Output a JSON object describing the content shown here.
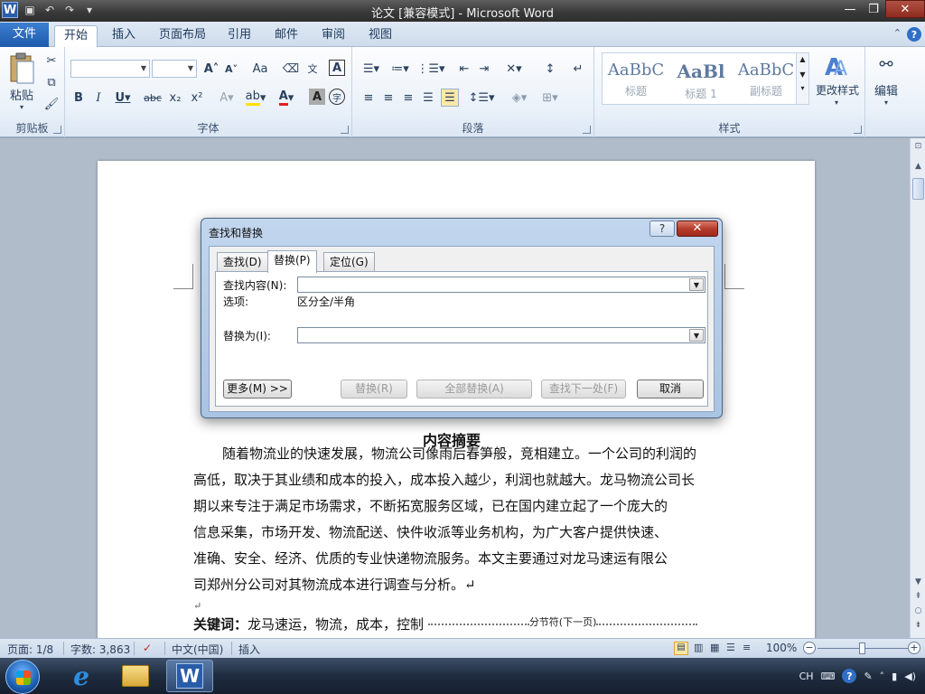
{
  "window": {
    "title": "论文 [兼容模式] - Microsoft Word",
    "logo_letter": "W",
    "controls": {
      "minimize": "—",
      "maximize": "❐",
      "close": "✕"
    }
  },
  "ribbon": {
    "tabs": [
      "文件",
      "开始",
      "插入",
      "页面布局",
      "引用",
      "邮件",
      "审阅",
      "视图"
    ],
    "active_tab": "开始",
    "groups": {
      "clipboard": {
        "label": "剪贴板",
        "paste": "粘贴"
      },
      "font": {
        "label": "字体",
        "font_name": "",
        "font_size": ""
      },
      "paragraph": {
        "label": "段落"
      },
      "styles": {
        "label": "样式",
        "items": [
          {
            "preview": "AaBbC",
            "name": "标题"
          },
          {
            "preview": "AaBl",
            "name": "标题 1"
          },
          {
            "preview": "AaBbC",
            "name": "副标题"
          }
        ],
        "change_styles": "更改样式"
      },
      "editing": {
        "label": "编辑"
      }
    }
  },
  "document": {
    "heading": "内容摘要",
    "paragraph_lines": [
      "随着物流业的快速发展，物流公司像雨后春笋般，竞相建立。一个公司的利润的",
      "高低，取决于其业绩和成本的投入，成本投入越少，利润也就越大。龙马物流公司长",
      "期以来专注于满足市场需求，不断拓宽服务区域，已在国内建立起了一个庞大的",
      "信息采集，市场开发、物流配送、快件收派等业务机构，为广大客户提供快速、",
      "准确、安全、经济、优质的专业快递物流服务。本文主要通过对龙马速运有限公",
      "司郑州分公司对其物流成本进行调查与分析。↵"
    ],
    "para_mark": "↵",
    "keywords_label": "关键词：",
    "keywords_text": "龙马速运，物流，成本，控制",
    "section_break": "分节符(下一页)"
  },
  "dialog": {
    "title": "查找和替换",
    "help": "?",
    "close": "✕",
    "tabs": [
      "查找(D)",
      "替换(P)",
      "定位(G)"
    ],
    "active_tab": "替换(P)",
    "find_label": "查找内容(N):",
    "find_value": "",
    "options_label": "选项:",
    "options_value": "区分全/半角",
    "replace_label": "替换为(I):",
    "replace_value": "",
    "buttons": {
      "more": "更多(M) >>",
      "replace": "替换(R)",
      "replace_all": "全部替换(A)",
      "find_next": "查找下一处(F)",
      "cancel": "取消"
    }
  },
  "statusbar": {
    "page": "页面: 1/8",
    "words": "字数: 3,863",
    "language": "中文(中国)",
    "mode": "插入",
    "zoom": "100%",
    "zoom_level": 1.0
  },
  "taskbar": {
    "tray_lang": "CH"
  }
}
